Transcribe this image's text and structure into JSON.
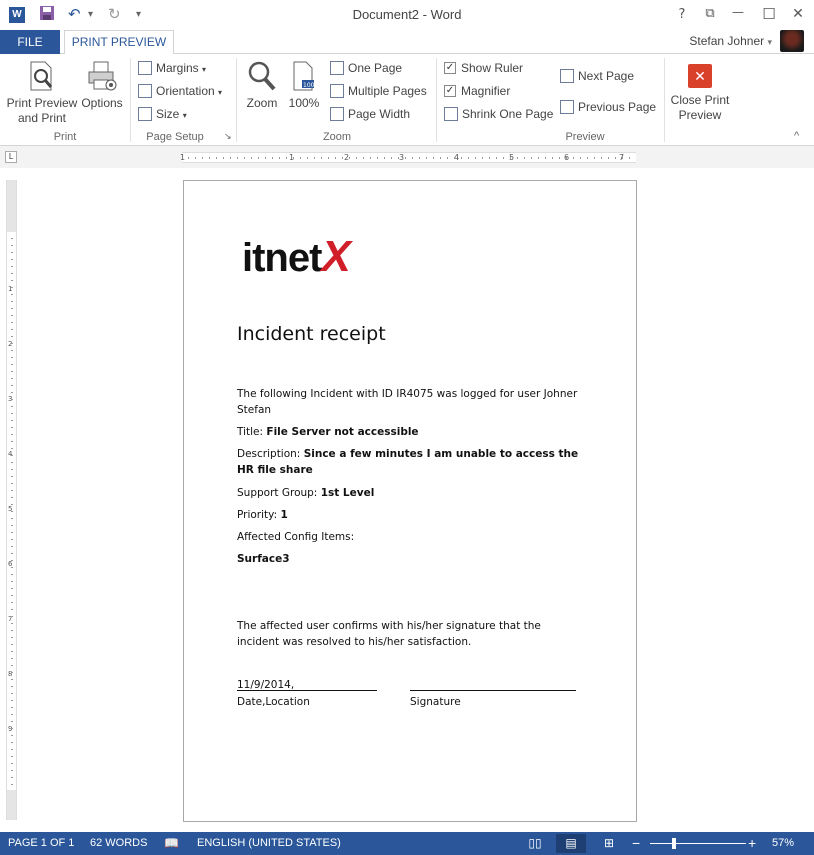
{
  "window": {
    "title": "Document2 - Word",
    "help": "?",
    "restore_ribbon": "⧉",
    "minimize": "—",
    "maximize": "☐",
    "close": "✕"
  },
  "qat": {
    "app_icon_letter": "W",
    "save": "💾",
    "undo": "↶",
    "undo_dropdown": "▾",
    "redo": "↻",
    "customize": "▾"
  },
  "tabs": {
    "file": "FILE",
    "print_preview": "PRINT PREVIEW"
  },
  "user": {
    "name": "Stefan Johner",
    "dropdown": "▾"
  },
  "ribbon": {
    "print_group": {
      "label": "Print",
      "print_preview_line1": "Print Preview",
      "print_preview_line2": "and Print",
      "options": "Options"
    },
    "page_setup_group": {
      "label": "Page Setup",
      "margins": "Margins",
      "orientation": "Orientation",
      "size": "Size",
      "dropdown": "▾",
      "launcher": "↘"
    },
    "zoom_group": {
      "label": "Zoom",
      "zoom": "Zoom",
      "zoom100": "100%",
      "one_page": "One Page",
      "multiple_pages": "Multiple Pages",
      "page_width": "Page Width"
    },
    "preview_group": {
      "label": "Preview",
      "show_ruler": "Show Ruler",
      "magnifier": "Magnifier",
      "shrink_one_page": "Shrink One Page",
      "next_page": "Next Page",
      "previous_page": "Previous Page",
      "check": "✓",
      "close_line1": "Close Print",
      "close_line2": "Preview",
      "close_glyph": "✕",
      "collapse": "^"
    }
  },
  "ruler": {
    "corner": "L",
    "h_numbers": [
      "1",
      "1",
      "2",
      "3",
      "4",
      "5",
      "6",
      "7"
    ],
    "v_numbers": [
      "1",
      "2",
      "3",
      "4",
      "5",
      "6",
      "7",
      "8",
      "9"
    ]
  },
  "document": {
    "logo_part1": "itnet",
    "logo_part2": "X",
    "title": "Incident receipt",
    "intro": "The following Incident with ID IR4075 was logged for user Johner Stefan",
    "title_label": "Title: ",
    "title_value": "File Server not accessible",
    "description_label": "Description: ",
    "description_value": "Since a few minutes I am unable to access the HR file share",
    "support_group_label": "Support Group: ",
    "support_group_value": "1st Level",
    "priority_label": "Priority: ",
    "priority_value": "1",
    "affected_items_label": "Affected Config Items:",
    "affected_items_value": "Surface3",
    "confirmation": "The affected user confirms with his/her signature that the incident was resolved to his/her satisfaction.",
    "date_value": "11/9/2014, ",
    "date_label": "Date,Location",
    "signature_label": "Signature"
  },
  "status": {
    "page": "PAGE 1 OF 1",
    "words": "62 WORDS",
    "proofing_icon": "📖",
    "language": "ENGLISH (UNITED STATES)",
    "read_mode": "▯▯",
    "print_layout": "▤",
    "web_layout": "⊞",
    "zoom_out": "−",
    "zoom_in": "+",
    "zoom": "57%"
  },
  "colors": {
    "accent": "#2b579a",
    "logo_red": "#d11f2a",
    "close_red": "#d9412a"
  }
}
